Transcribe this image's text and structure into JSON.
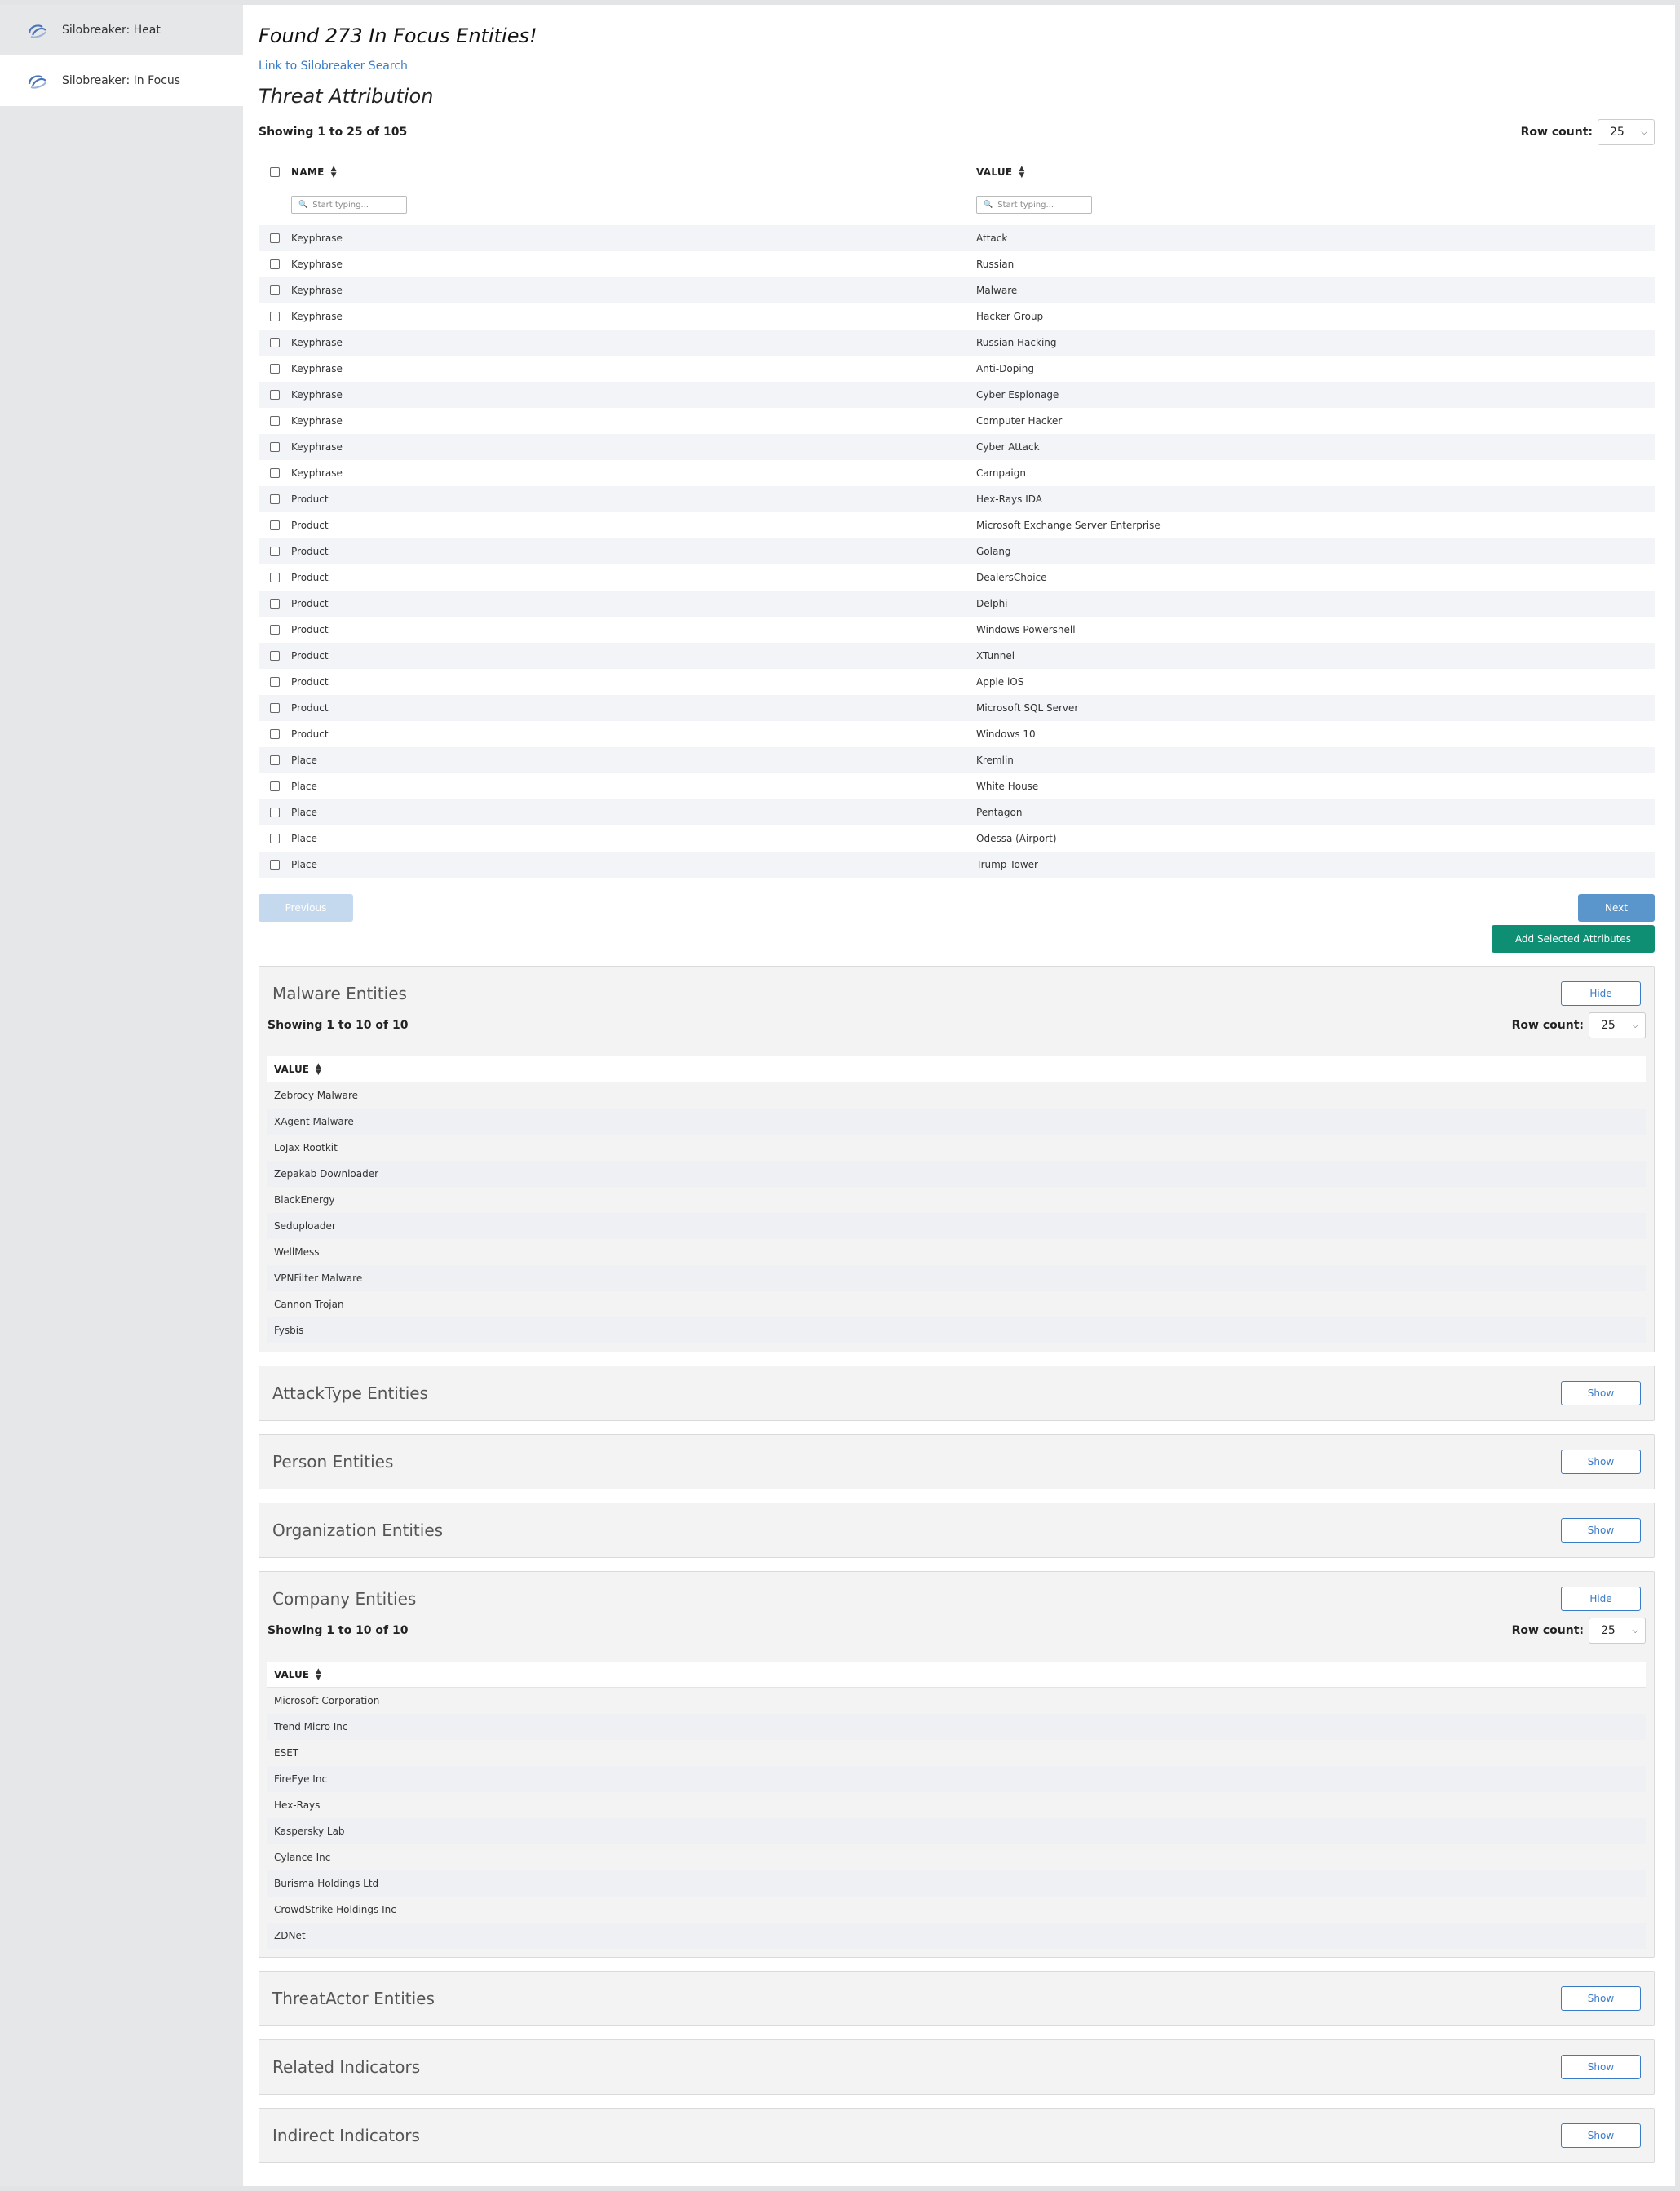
{
  "sidebar": {
    "items": [
      {
        "label": "Silobreaker: Heat"
      },
      {
        "label": "Silobreaker: In Focus"
      }
    ]
  },
  "header": {
    "found_title": "Found 273 In Focus Entities!",
    "search_link": "Link to Silobreaker Search",
    "section_title": "Threat Attribution"
  },
  "threat_table": {
    "showing": "Showing 1 to 25 of 105",
    "row_count_label": "Row count:",
    "row_count_value": "25",
    "columns": {
      "name": "NAME",
      "value": "VALUE"
    },
    "filter_placeholder": "Start typing...",
    "rows": [
      {
        "name": "Keyphrase",
        "value": "Attack"
      },
      {
        "name": "Keyphrase",
        "value": "Russian"
      },
      {
        "name": "Keyphrase",
        "value": "Malware"
      },
      {
        "name": "Keyphrase",
        "value": "Hacker Group"
      },
      {
        "name": "Keyphrase",
        "value": "Russian Hacking"
      },
      {
        "name": "Keyphrase",
        "value": "Anti-Doping"
      },
      {
        "name": "Keyphrase",
        "value": "Cyber Espionage"
      },
      {
        "name": "Keyphrase",
        "value": "Computer Hacker"
      },
      {
        "name": "Keyphrase",
        "value": "Cyber Attack"
      },
      {
        "name": "Keyphrase",
        "value": "Campaign"
      },
      {
        "name": "Product",
        "value": "Hex-Rays IDA"
      },
      {
        "name": "Product",
        "value": "Microsoft Exchange Server Enterprise"
      },
      {
        "name": "Product",
        "value": "Golang"
      },
      {
        "name": "Product",
        "value": "DealersChoice"
      },
      {
        "name": "Product",
        "value": "Delphi"
      },
      {
        "name": "Product",
        "value": "Windows Powershell"
      },
      {
        "name": "Product",
        "value": "XTunnel"
      },
      {
        "name": "Product",
        "value": "Apple iOS"
      },
      {
        "name": "Product",
        "value": "Microsoft SQL Server"
      },
      {
        "name": "Product",
        "value": "Windows 10"
      },
      {
        "name": "Place",
        "value": "Kremlin"
      },
      {
        "name": "Place",
        "value": "White House"
      },
      {
        "name": "Place",
        "value": "Pentagon"
      },
      {
        "name": "Place",
        "value": "Odessa (Airport)"
      },
      {
        "name": "Place",
        "value": "Trump Tower"
      }
    ],
    "previous_label": "Previous",
    "next_label": "Next",
    "add_label": "Add Selected Attributes"
  },
  "malware": {
    "title": "Malware Entities",
    "toggle_label": "Hide",
    "showing": "Showing 1 to 10 of 10",
    "row_count_label": "Row count:",
    "row_count_value": "25",
    "column": "VALUE",
    "rows": [
      "Zebrocy Malware",
      "XAgent Malware",
      "LoJax Rootkit",
      "Zepakab Downloader",
      "BlackEnergy",
      "Seduploader",
      "WellMess",
      "VPNFilter Malware",
      "Cannon Trojan",
      "Fysbis"
    ]
  },
  "attacktype": {
    "title": "AttackType Entities",
    "toggle_label": "Show"
  },
  "person": {
    "title": "Person Entities",
    "toggle_label": "Show"
  },
  "organization": {
    "title": "Organization Entities",
    "toggle_label": "Show"
  },
  "company": {
    "title": "Company Entities",
    "toggle_label": "Hide",
    "showing": "Showing 1 to 10 of 10",
    "row_count_label": "Row count:",
    "row_count_value": "25",
    "column": "VALUE",
    "rows": [
      "Microsoft Corporation",
      "Trend Micro Inc",
      "ESET",
      "FireEye Inc",
      "Hex-Rays",
      "Kaspersky Lab",
      "Cylance Inc",
      "Burisma Holdings Ltd",
      "CrowdStrike Holdings Inc",
      "ZDNet"
    ]
  },
  "threatactor": {
    "title": "ThreatActor Entities",
    "toggle_label": "Show"
  },
  "related": {
    "title": "Related Indicators",
    "toggle_label": "Show"
  },
  "indirect": {
    "title": "Indirect Indicators",
    "toggle_label": "Show"
  },
  "colors": {
    "link": "#3a7bc8",
    "next_button": "#5a95cc",
    "previous_button": "#c5d9ee",
    "add_button": "#0e8e73",
    "panel_bg": "#f3f3f4",
    "sidebar_bg": "#e6e7e9"
  }
}
